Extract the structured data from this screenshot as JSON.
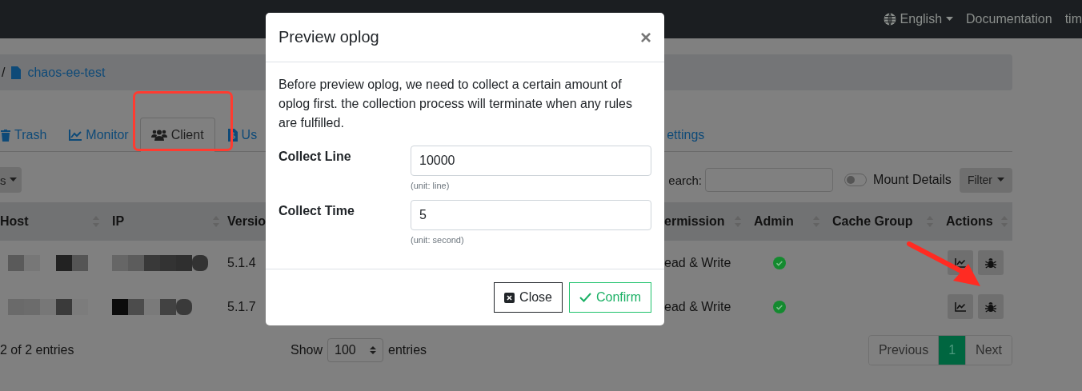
{
  "navbar": {
    "language": "English",
    "links": [
      "Documentation",
      "tim"
    ]
  },
  "breadcrumb": {
    "separator": "/",
    "current": "chaos-ee-test"
  },
  "tabs": [
    {
      "label": "Trash",
      "selected": false
    },
    {
      "label": "Monitor",
      "selected": false
    },
    {
      "label": "Client",
      "selected": true
    },
    {
      "label": "Us",
      "selected": false
    },
    {
      "label": "ettings",
      "selected": false
    }
  ],
  "toolbar": {
    "menu_label": "s",
    "search_label": "earch:",
    "mount_details": {
      "label": "Mount Details",
      "on": false
    },
    "filter": "Filter"
  },
  "table": {
    "columns": [
      "Host",
      "IP",
      "Versio",
      "ermission",
      "Admin",
      "Cache Group",
      "Actions"
    ],
    "rows": [
      {
        "version": "5.1.4",
        "permission": "ead & Write",
        "admin": true
      },
      {
        "version": "5.1.7",
        "permission": "ead & Write",
        "admin": true
      }
    ]
  },
  "footer": {
    "info": "2 of 2 entries",
    "show_label": "Show",
    "page_size": "100",
    "entries_label": "entries",
    "pages": [
      {
        "label": "Previous",
        "selected": false
      },
      {
        "label": "1",
        "selected": true
      },
      {
        "label": "Next",
        "selected": false
      }
    ]
  },
  "modal": {
    "title": "Preview oplog",
    "close": "×",
    "description": "Before preview oplog, we need to collect a certain amount of oplog first. the collection process will terminate when any rules are fulfilled.",
    "fields": [
      {
        "label": "Collect Line",
        "value": "10000",
        "hint": "(unit: line)"
      },
      {
        "label": "Collect Time",
        "value": "5",
        "hint": "(unit: second)"
      }
    ],
    "buttons": [
      {
        "label": "Close",
        "kind": "close"
      },
      {
        "label": "Confirm",
        "kind": "confirm"
      }
    ]
  },
  "annotations": {
    "highlight_box": true,
    "arrow": true
  }
}
